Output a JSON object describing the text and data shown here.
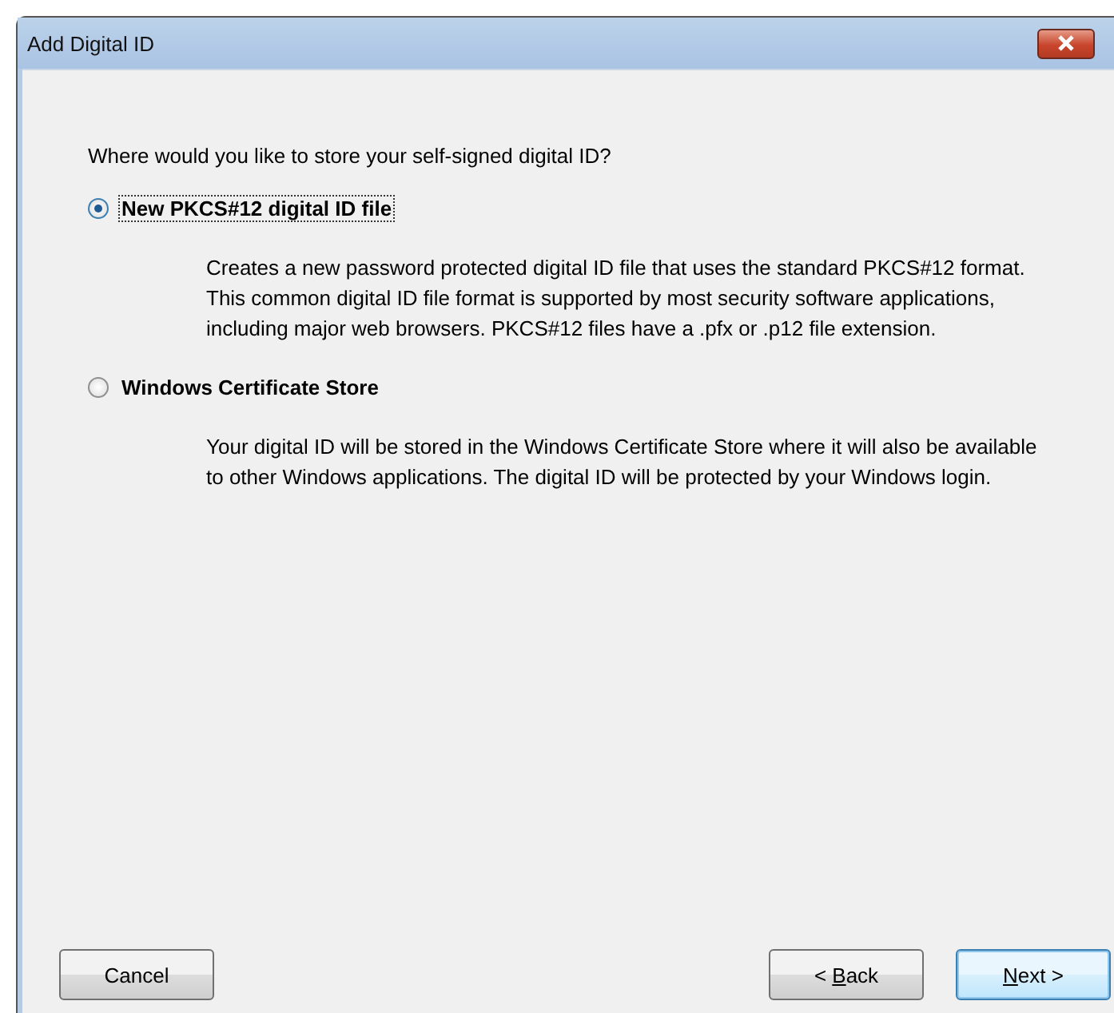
{
  "window": {
    "title": "Add Digital ID"
  },
  "question": "Where would you like to store your self-signed digital ID?",
  "options": [
    {
      "label": "New PKCS#12 digital ID file",
      "selected": true,
      "description": [
        "Creates a new password protected digital ID file that uses the standard PKCS#12 format.",
        "This common digital ID file format is supported by most security software applications,",
        "including major web browsers. PKCS#12 files have a .pfx or .p12 file extension."
      ]
    },
    {
      "label": "Windows Certificate Store",
      "selected": false,
      "description": [
        "Your digital ID will be stored in the Windows Certificate Store where it will also be available",
        "to other Windows applications. The digital ID will be protected by your Windows login."
      ]
    }
  ],
  "left_buttons": [
    {
      "label": "Cancel",
      "default": false
    }
  ],
  "right_buttons": [
    {
      "before_key": "< ",
      "access_key": "B",
      "after_key": "ack",
      "default": false
    },
    {
      "access_key": "N",
      "after_key": "ext >",
      "default": true
    }
  ]
}
